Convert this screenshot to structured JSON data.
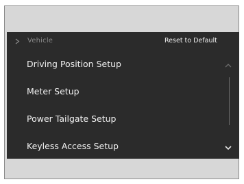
{
  "header": {
    "back_icon": "chevron-right-icon",
    "breadcrumb": "Vehicle",
    "reset_label": "Reset to Default"
  },
  "menu": {
    "items": [
      {
        "label": "Driving Position Setup"
      },
      {
        "label": "Meter Setup"
      },
      {
        "label": "Power Tailgate Setup"
      },
      {
        "label": "Keyless Access Setup"
      }
    ]
  },
  "scroll": {
    "up_icon": "chevron-up-icon",
    "down_icon": "chevron-down-icon"
  },
  "colors": {
    "screen_bg": "#2b2b2b",
    "outer_bg": "#d7d7d7",
    "text": "#f2f2f2",
    "muted_text": "#8a8a8a"
  }
}
